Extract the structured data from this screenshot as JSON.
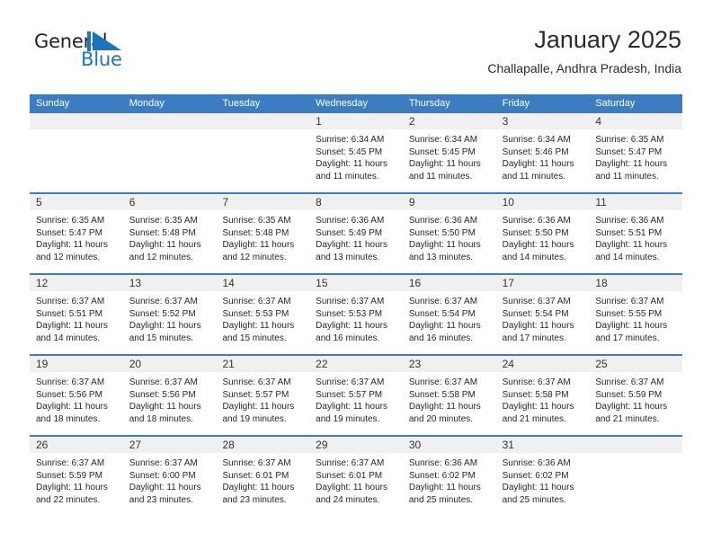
{
  "brand": {
    "name_part1": "General",
    "name_part2": "Blue",
    "mark": "triangle-logo-mark",
    "color_primary": "#1c75bc",
    "color_text": "#231f20"
  },
  "header": {
    "title": "January 2025",
    "subtitle": "Challapalle, Andhra Pradesh, India"
  },
  "theme": {
    "header_blue": "#3b7dc0",
    "band_gray": "#f0f0f0",
    "text_dark": "#262626"
  },
  "calendar": {
    "weekdays": [
      "Sunday",
      "Monday",
      "Tuesday",
      "Wednesday",
      "Thursday",
      "Friday",
      "Saturday"
    ],
    "weeks": [
      [
        {
          "day": "",
          "sunrise": "",
          "sunset": "",
          "daylight_a": "",
          "daylight_b": ""
        },
        {
          "day": "",
          "sunrise": "",
          "sunset": "",
          "daylight_a": "",
          "daylight_b": ""
        },
        {
          "day": "",
          "sunrise": "",
          "sunset": "",
          "daylight_a": "",
          "daylight_b": ""
        },
        {
          "day": "1",
          "sunrise": "Sunrise: 6:34 AM",
          "sunset": "Sunset: 5:45 PM",
          "daylight_a": "Daylight: 11 hours",
          "daylight_b": "and 11 minutes."
        },
        {
          "day": "2",
          "sunrise": "Sunrise: 6:34 AM",
          "sunset": "Sunset: 5:45 PM",
          "daylight_a": "Daylight: 11 hours",
          "daylight_b": "and 11 minutes."
        },
        {
          "day": "3",
          "sunrise": "Sunrise: 6:34 AM",
          "sunset": "Sunset: 5:46 PM",
          "daylight_a": "Daylight: 11 hours",
          "daylight_b": "and 11 minutes."
        },
        {
          "day": "4",
          "sunrise": "Sunrise: 6:35 AM",
          "sunset": "Sunset: 5:47 PM",
          "daylight_a": "Daylight: 11 hours",
          "daylight_b": "and 11 minutes."
        }
      ],
      [
        {
          "day": "5",
          "sunrise": "Sunrise: 6:35 AM",
          "sunset": "Sunset: 5:47 PM",
          "daylight_a": "Daylight: 11 hours",
          "daylight_b": "and 12 minutes."
        },
        {
          "day": "6",
          "sunrise": "Sunrise: 6:35 AM",
          "sunset": "Sunset: 5:48 PM",
          "daylight_a": "Daylight: 11 hours",
          "daylight_b": "and 12 minutes."
        },
        {
          "day": "7",
          "sunrise": "Sunrise: 6:35 AM",
          "sunset": "Sunset: 5:48 PM",
          "daylight_a": "Daylight: 11 hours",
          "daylight_b": "and 12 minutes."
        },
        {
          "day": "8",
          "sunrise": "Sunrise: 6:36 AM",
          "sunset": "Sunset: 5:49 PM",
          "daylight_a": "Daylight: 11 hours",
          "daylight_b": "and 13 minutes."
        },
        {
          "day": "9",
          "sunrise": "Sunrise: 6:36 AM",
          "sunset": "Sunset: 5:50 PM",
          "daylight_a": "Daylight: 11 hours",
          "daylight_b": "and 13 minutes."
        },
        {
          "day": "10",
          "sunrise": "Sunrise: 6:36 AM",
          "sunset": "Sunset: 5:50 PM",
          "daylight_a": "Daylight: 11 hours",
          "daylight_b": "and 14 minutes."
        },
        {
          "day": "11",
          "sunrise": "Sunrise: 6:36 AM",
          "sunset": "Sunset: 5:51 PM",
          "daylight_a": "Daylight: 11 hours",
          "daylight_b": "and 14 minutes."
        }
      ],
      [
        {
          "day": "12",
          "sunrise": "Sunrise: 6:37 AM",
          "sunset": "Sunset: 5:51 PM",
          "daylight_a": "Daylight: 11 hours",
          "daylight_b": "and 14 minutes."
        },
        {
          "day": "13",
          "sunrise": "Sunrise: 6:37 AM",
          "sunset": "Sunset: 5:52 PM",
          "daylight_a": "Daylight: 11 hours",
          "daylight_b": "and 15 minutes."
        },
        {
          "day": "14",
          "sunrise": "Sunrise: 6:37 AM",
          "sunset": "Sunset: 5:53 PM",
          "daylight_a": "Daylight: 11 hours",
          "daylight_b": "and 15 minutes."
        },
        {
          "day": "15",
          "sunrise": "Sunrise: 6:37 AM",
          "sunset": "Sunset: 5:53 PM",
          "daylight_a": "Daylight: 11 hours",
          "daylight_b": "and 16 minutes."
        },
        {
          "day": "16",
          "sunrise": "Sunrise: 6:37 AM",
          "sunset": "Sunset: 5:54 PM",
          "daylight_a": "Daylight: 11 hours",
          "daylight_b": "and 16 minutes."
        },
        {
          "day": "17",
          "sunrise": "Sunrise: 6:37 AM",
          "sunset": "Sunset: 5:54 PM",
          "daylight_a": "Daylight: 11 hours",
          "daylight_b": "and 17 minutes."
        },
        {
          "day": "18",
          "sunrise": "Sunrise: 6:37 AM",
          "sunset": "Sunset: 5:55 PM",
          "daylight_a": "Daylight: 11 hours",
          "daylight_b": "and 17 minutes."
        }
      ],
      [
        {
          "day": "19",
          "sunrise": "Sunrise: 6:37 AM",
          "sunset": "Sunset: 5:56 PM",
          "daylight_a": "Daylight: 11 hours",
          "daylight_b": "and 18 minutes."
        },
        {
          "day": "20",
          "sunrise": "Sunrise: 6:37 AM",
          "sunset": "Sunset: 5:56 PM",
          "daylight_a": "Daylight: 11 hours",
          "daylight_b": "and 18 minutes."
        },
        {
          "day": "21",
          "sunrise": "Sunrise: 6:37 AM",
          "sunset": "Sunset: 5:57 PM",
          "daylight_a": "Daylight: 11 hours",
          "daylight_b": "and 19 minutes."
        },
        {
          "day": "22",
          "sunrise": "Sunrise: 6:37 AM",
          "sunset": "Sunset: 5:57 PM",
          "daylight_a": "Daylight: 11 hours",
          "daylight_b": "and 19 minutes."
        },
        {
          "day": "23",
          "sunrise": "Sunrise: 6:37 AM",
          "sunset": "Sunset: 5:58 PM",
          "daylight_a": "Daylight: 11 hours",
          "daylight_b": "and 20 minutes."
        },
        {
          "day": "24",
          "sunrise": "Sunrise: 6:37 AM",
          "sunset": "Sunset: 5:58 PM",
          "daylight_a": "Daylight: 11 hours",
          "daylight_b": "and 21 minutes."
        },
        {
          "day": "25",
          "sunrise": "Sunrise: 6:37 AM",
          "sunset": "Sunset: 5:59 PM",
          "daylight_a": "Daylight: 11 hours",
          "daylight_b": "and 21 minutes."
        }
      ],
      [
        {
          "day": "26",
          "sunrise": "Sunrise: 6:37 AM",
          "sunset": "Sunset: 5:59 PM",
          "daylight_a": "Daylight: 11 hours",
          "daylight_b": "and 22 minutes."
        },
        {
          "day": "27",
          "sunrise": "Sunrise: 6:37 AM",
          "sunset": "Sunset: 6:00 PM",
          "daylight_a": "Daylight: 11 hours",
          "daylight_b": "and 23 minutes."
        },
        {
          "day": "28",
          "sunrise": "Sunrise: 6:37 AM",
          "sunset": "Sunset: 6:01 PM",
          "daylight_a": "Daylight: 11 hours",
          "daylight_b": "and 23 minutes."
        },
        {
          "day": "29",
          "sunrise": "Sunrise: 6:37 AM",
          "sunset": "Sunset: 6:01 PM",
          "daylight_a": "Daylight: 11 hours",
          "daylight_b": "and 24 minutes."
        },
        {
          "day": "30",
          "sunrise": "Sunrise: 6:36 AM",
          "sunset": "Sunset: 6:02 PM",
          "daylight_a": "Daylight: 11 hours",
          "daylight_b": "and 25 minutes."
        },
        {
          "day": "31",
          "sunrise": "Sunrise: 6:36 AM",
          "sunset": "Sunset: 6:02 PM",
          "daylight_a": "Daylight: 11 hours",
          "daylight_b": "and 25 minutes."
        },
        {
          "day": "",
          "sunrise": "",
          "sunset": "",
          "daylight_a": "",
          "daylight_b": ""
        }
      ]
    ]
  }
}
